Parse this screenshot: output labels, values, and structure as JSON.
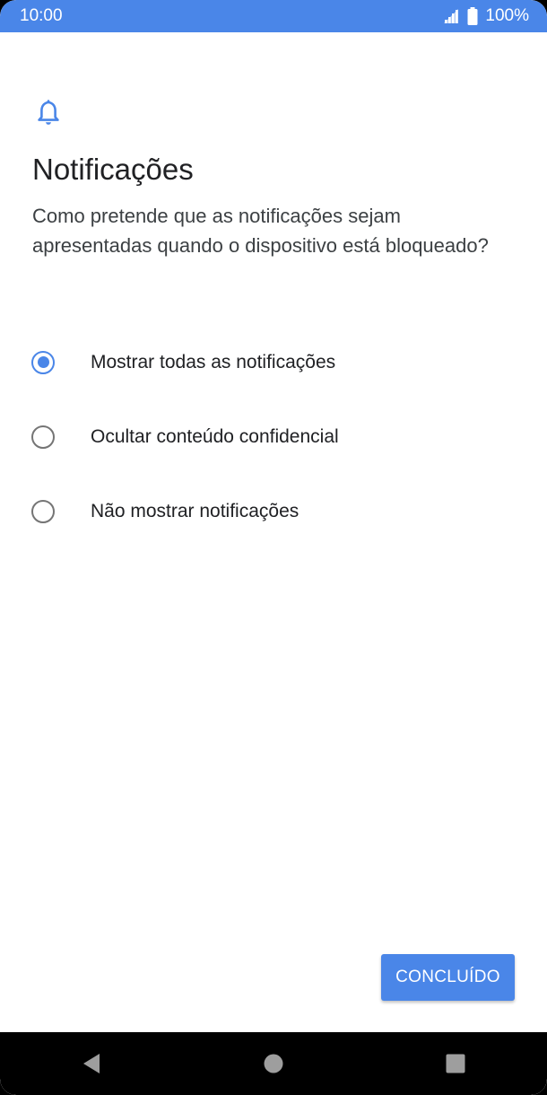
{
  "status_bar": {
    "time": "10:00",
    "battery": "100%",
    "icons": [
      "signal-icon",
      "battery-icon"
    ]
  },
  "colors": {
    "accent": "#4a86e8",
    "text_primary": "#202124",
    "text_secondary": "#3c4043",
    "radio_unchecked": "#757575"
  },
  "header": {
    "icon": "bell-icon",
    "title": "Notificações",
    "description": "Como pretende que as notificações sejam apresentadas quando o dispositivo está bloqueado?"
  },
  "options": [
    {
      "label": "Mostrar todas as notificações",
      "selected": true
    },
    {
      "label": "Ocultar conteúdo confidencial",
      "selected": false
    },
    {
      "label": "Não mostrar notificações",
      "selected": false
    }
  ],
  "actions": {
    "done_label": "CONCLUÍDO"
  },
  "nav_bar": {
    "icons": [
      "back-icon",
      "home-icon",
      "recents-icon"
    ]
  }
}
